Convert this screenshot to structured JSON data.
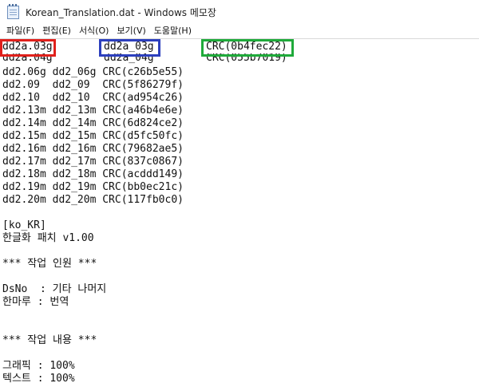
{
  "window": {
    "title": "Korean_Translation.dat - Windows 메모장",
    "icon": "notepad-icon"
  },
  "menu": [
    {
      "label": "파일(F)"
    },
    {
      "label": "편집(E)"
    },
    {
      "label": "서식(O)"
    },
    {
      "label": "보기(V)"
    },
    {
      "label": "도움말(H)"
    }
  ],
  "highlight": {
    "first": {
      "col1": "dd2a.03g",
      "col2": "dd2a_03g",
      "col3": "CRC(0b4fec22)"
    },
    "second_partial": {
      "col1": "dd2a.04g",
      "col2": "dd2a_04g",
      "col3": "CRC(055b7019)"
    },
    "colors": {
      "red": "#e0201b",
      "blue": "#2c3fbd",
      "green": "#1faa3a"
    }
  },
  "lines": [
    "dd2.06g dd2_06g CRC(c26b5e55)",
    "dd2.09  dd2_09  CRC(5f86279f)",
    "dd2.10  dd2_10  CRC(ad954c26)",
    "dd2.13m dd2_13m CRC(a46b4e6e)",
    "dd2.14m dd2_14m CRC(6d824ce2)",
    "dd2.15m dd2_15m CRC(d5fc50fc)",
    "dd2.16m dd2_16m CRC(79682ae5)",
    "dd2.17m dd2_17m CRC(837c0867)",
    "dd2.18m dd2_18m CRC(acddd149)",
    "dd2.19m dd2_19m CRC(bb0ec21c)",
    "dd2.20m dd2_20m CRC(117fb0c0)",
    "",
    "[ko_KR]",
    "한글화 패치 v1.00",
    "",
    "*** 작업 인원 ***",
    "",
    "DsNo  : 기타 나머지",
    "한마루 : 번역",
    "",
    "",
    "*** 작업 내용 ***",
    "",
    "그래픽 : 100%",
    "텍스트 : 100%"
  ]
}
